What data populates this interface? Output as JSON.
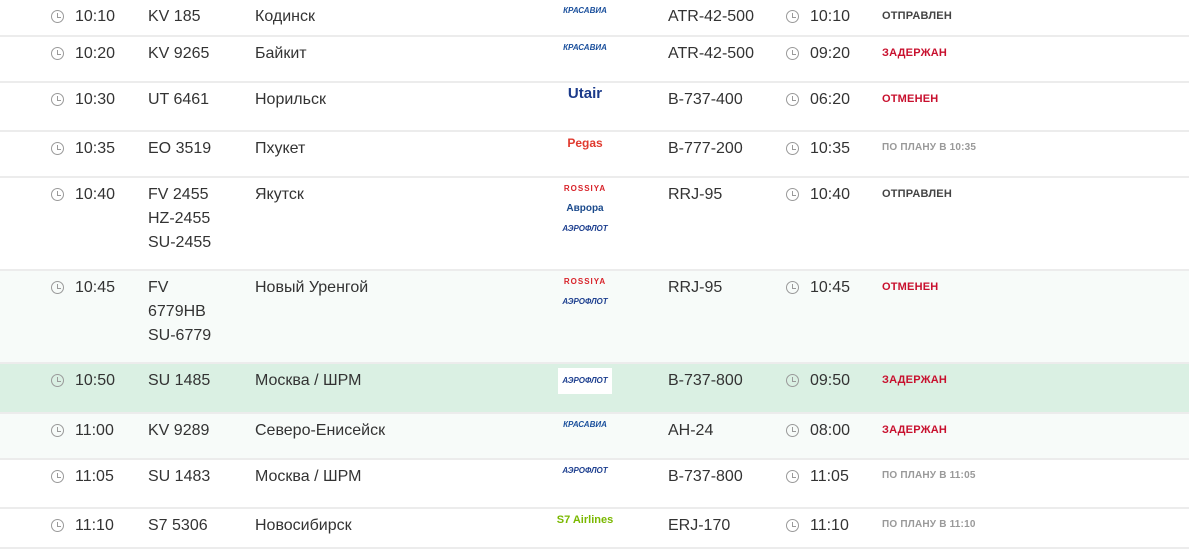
{
  "colors": {
    "delayed": "#c8102e",
    "cancelled": "#c8102e",
    "departed": "#444444",
    "scheduled": "#999999",
    "highlight_row": "#daf0e3"
  },
  "flights": [
    {
      "time": "10:10",
      "flight": [
        "KV 185"
      ],
      "city": "Кодинск",
      "airlines": [
        "КРАСАВИА"
      ],
      "aircraft": "ATR-42-500",
      "actual": "10:10",
      "status": "ОТПРАВЛЕН",
      "status_type": "sent"
    },
    {
      "time": "10:20",
      "flight": [
        "KV 9265"
      ],
      "city": "Байкит",
      "airlines": [
        "КРАСАВИА"
      ],
      "aircraft": "ATR-42-500",
      "actual": "09:20",
      "status": "ЗАДЕРЖАН",
      "status_type": "red"
    },
    {
      "time": "10:30",
      "flight": [
        "UT 6461"
      ],
      "city": "Норильск",
      "airlines": [
        "Utair"
      ],
      "aircraft": "B-737-400",
      "actual": "06:20",
      "status": "ОТМЕНЕН",
      "status_type": "red"
    },
    {
      "time": "10:35",
      "flight": [
        "EO 3519"
      ],
      "city": "Пхукет",
      "airlines": [
        "Pegas"
      ],
      "aircraft": "B-777-200",
      "actual": "10:35",
      "status": "ПО ПЛАНУ В 10:35",
      "status_type": "plan"
    },
    {
      "time": "10:40",
      "flight": [
        "FV 2455",
        "HZ-2455",
        "SU-2455"
      ],
      "city": "Якутск",
      "airlines": [
        "ROSSIYA",
        "Аврора",
        "АЭРОФЛОТ"
      ],
      "aircraft": "RRJ-95",
      "actual": "10:40",
      "status": "ОТПРАВЛЕН",
      "status_type": "sent"
    },
    {
      "time": "10:45",
      "flight": [
        "FV",
        "6779HB",
        "SU-6779"
      ],
      "city": "Новый Уренгой",
      "airlines": [
        "ROSSIYA",
        "АЭРОФЛОТ"
      ],
      "aircraft": "RRJ-95",
      "actual": "10:45",
      "status": "ОТМЕНЕН",
      "status_type": "red"
    },
    {
      "time": "10:50",
      "flight": [
        "SU 1485"
      ],
      "city": "Москва / ШРМ",
      "airlines": [
        "АЭРОФЛОТ"
      ],
      "aircraft": "B-737-800",
      "actual": "09:50",
      "status": "ЗАДЕРЖАН",
      "status_type": "red"
    },
    {
      "time": "11:00",
      "flight": [
        "KV 9289"
      ],
      "city": "Северо-Енисейск",
      "airlines": [
        "КРАСАВИА"
      ],
      "aircraft": "АН-24",
      "actual": "08:00",
      "status": "ЗАДЕРЖАН",
      "status_type": "red"
    },
    {
      "time": "11:05",
      "flight": [
        "SU 1483"
      ],
      "city": "Москва / ШРМ",
      "airlines": [
        "АЭРОФЛОТ"
      ],
      "aircraft": "B-737-800",
      "actual": "11:05",
      "status": "ПО ПЛАНУ В 11:05",
      "status_type": "plan"
    },
    {
      "time": "11:10",
      "flight": [
        "S7 5306"
      ],
      "city": "Новосибирск",
      "airlines": [
        "S7 Airlines"
      ],
      "aircraft": "ERJ-170",
      "actual": "11:10",
      "status": "ПО ПЛАНУ В 11:10",
      "status_type": "plan"
    }
  ]
}
